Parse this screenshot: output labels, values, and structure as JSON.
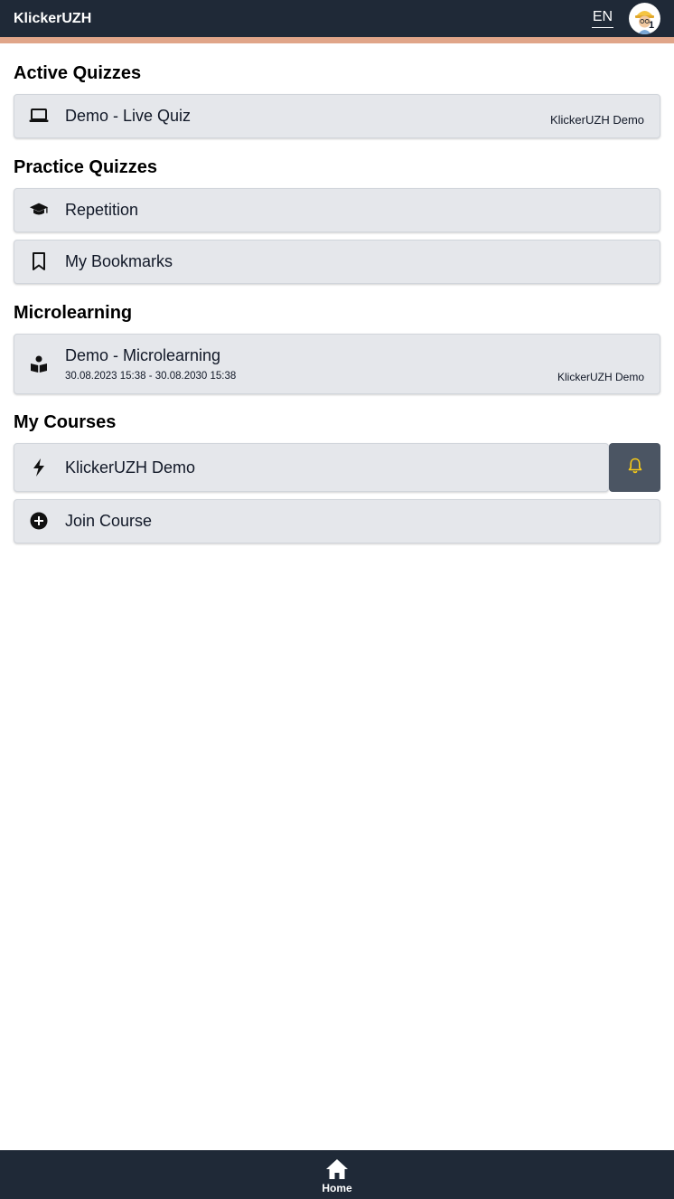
{
  "header": {
    "brand": "KlickerUZH",
    "language": "EN",
    "avatar_badge": "1"
  },
  "sections": {
    "active_quizzes": {
      "title": "Active Quizzes",
      "items": [
        {
          "label": "Demo - Live Quiz",
          "course": "KlickerUZH Demo",
          "icon": "laptop-icon"
        }
      ]
    },
    "practice_quizzes": {
      "title": "Practice Quizzes",
      "items": [
        {
          "label": "Repetition",
          "icon": "graduation-cap-icon"
        },
        {
          "label": "My Bookmarks",
          "icon": "bookmark-icon"
        }
      ]
    },
    "microlearning": {
      "title": "Microlearning",
      "items": [
        {
          "label": "Demo - Microlearning",
          "dates": "30.08.2023 15:38 - 30.08.2030 15:38",
          "course": "KlickerUZH Demo",
          "icon": "book-reader-icon"
        }
      ]
    },
    "my_courses": {
      "title": "My Courses",
      "items": [
        {
          "label": "KlickerUZH Demo",
          "icon": "bolt-icon"
        },
        {
          "label": "Join Course",
          "icon": "plus-circle-icon"
        }
      ]
    }
  },
  "bottom_nav": {
    "home_label": "Home"
  },
  "colors": {
    "header_bg": "#1f2937",
    "accent_line": "#e0a589",
    "card_bg": "#e5e7eb",
    "bell_button_bg": "#4b5563",
    "bell_icon": "#facc15"
  }
}
